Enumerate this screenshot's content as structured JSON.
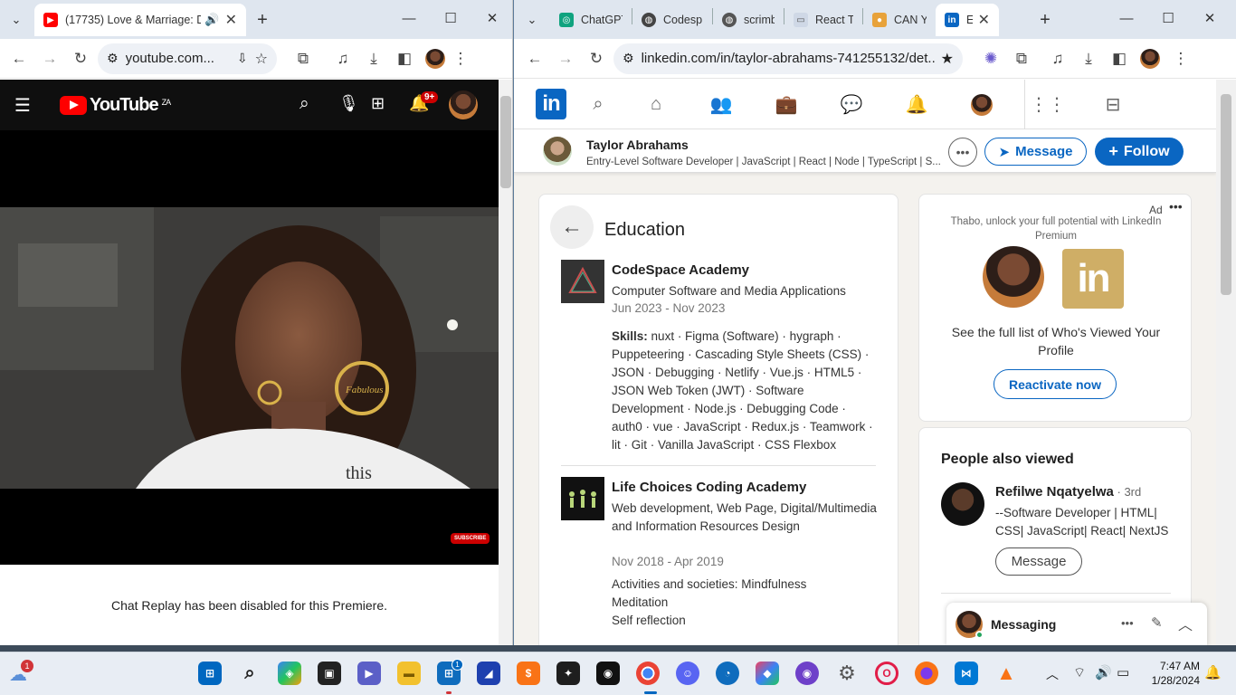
{
  "left_browser": {
    "tab_title": "(17735) Love & Marriage: D",
    "url": "youtube.com...",
    "youtube": {
      "logo_text": "YouTube",
      "country": "ZA",
      "notif_count": "9+",
      "earrings_text": "Fabulous",
      "shirt_text": "this",
      "subscribe_label": "SUBSCRIBE",
      "chat_replay": "Chat Replay has been disabled for this Premiere."
    }
  },
  "right_browser": {
    "tabs": [
      {
        "title": "ChatGPT",
        "color": "#10a37f"
      },
      {
        "title": "Codesp",
        "color": "#444444"
      },
      {
        "title": "scrimba",
        "color": "#555555"
      },
      {
        "title": "React T",
        "color": "#8a8a8a"
      },
      {
        "title": "CAN YO",
        "color": "#e8a23a"
      },
      {
        "title": "Edu",
        "color": "#0a66c2"
      }
    ],
    "url": "linkedin.com/in/taylor-abrahams-741255132/det...",
    "profile": {
      "name": "Taylor Abrahams",
      "headline": "Entry-Level Software Developer | JavaScript | React | Node | TypeScript | S...",
      "message_label": "Message",
      "follow_label": "Follow"
    },
    "education": {
      "title": "Education",
      "entries": [
        {
          "school": "CodeSpace Academy",
          "degree": "Computer Software and Media Applications",
          "dates": "Jun 2023 - Nov 2023",
          "skills_label": "Skills:",
          "skills": "nuxt · Figma (Software) · hygraph · Puppeteering · Cascading Style Sheets (CSS) · JSON · Debugging · Netlify · Vue.js · HTML5 · JSON Web Token (JWT) · Software Development · Node.js · Debugging Code · auth0 · vue · JavaScript · Redux.js · Teamwork · lit · Git · Vanilla JavaScript · CSS Flexbox"
        },
        {
          "school": "Life Choices Coding Academy",
          "degree": "Web development, Web Page, Digital/Multimedia and Information Resources Design",
          "dates": "Nov 2018 - Apr 2019",
          "activities": "Activities and societies: Mindfulness Meditation",
          "extra": "Self reflection"
        }
      ]
    },
    "ad": {
      "label": "Ad",
      "promo": "Thabo, unlock your full potential with LinkedIn Premium",
      "text": "See the full list of Who's Viewed Your Profile",
      "button": "Reactivate now"
    },
    "people": {
      "title": "People also viewed",
      "name": "Refilwe Nqatyelwa",
      "degree": "· 3rd",
      "headline": "--Software Developer | HTML| CSS| JavaScript| React| NextJS",
      "button": "Message"
    },
    "messaging": {
      "label": "Messaging"
    }
  },
  "taskbar": {
    "weather_badge": "1",
    "store_badge": "1",
    "time": "7:47 AM",
    "date": "1/28/2024"
  },
  "colors": {
    "linkedin_blue": "#0a66c2",
    "youtube_red": "#ff0000"
  }
}
